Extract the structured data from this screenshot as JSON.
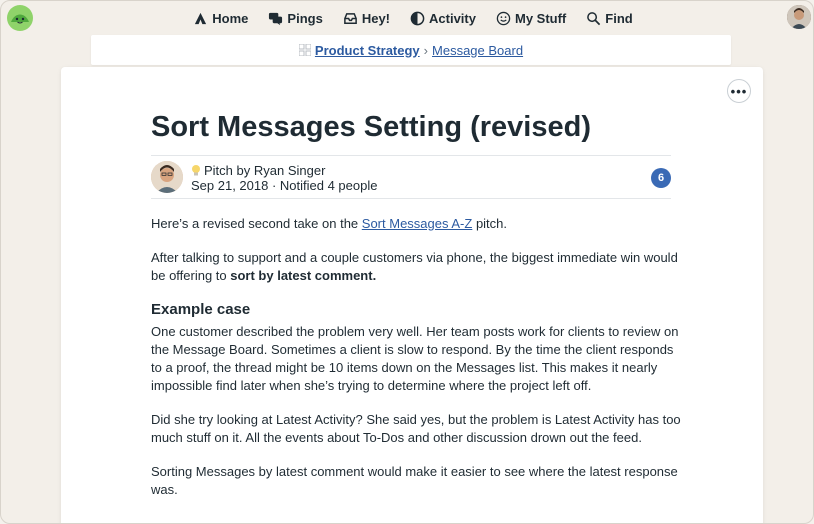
{
  "nav": {
    "home": "Home",
    "pings": "Pings",
    "hey": "Hey!",
    "activity": "Activity",
    "mystuff": "My Stuff",
    "find": "Find"
  },
  "breadcrumb": {
    "project": "Product Strategy",
    "separator": "›",
    "section": "Message Board"
  },
  "message": {
    "title": "Sort Messages Setting (revised)",
    "category_prefix": "Pitch by Ryan Singer",
    "meta": "Sep 21, 2018 · Notified 4 people",
    "comment_count": "6",
    "intro_before": "Here’s a revised second take on the ",
    "intro_link": "Sort Messages A-Z",
    "intro_after": " pitch.",
    "p2_before": "After talking to support and a couple customers via phone, the biggest immediate win would be offering to ",
    "p2_strong": "sort by latest comment.",
    "heading": "Example case",
    "p3": "One customer described the problem very well. Her team posts work for clients to review on the Message Board. Sometimes a client is slow to respond. By the time the client responds to a proof, the thread might be 10 items down on the Messages list. This makes it nearly impossible find later when she’s trying to determine where the project left off.",
    "p4": "Did she try looking at Latest Activity? She said yes, but the problem is Latest Activity has too much stuff on it. All the events about To-Dos and other discussion drown out the feed.",
    "p5": "Sorting Messages by latest comment would make it easier to see where the latest response was."
  },
  "colors": {
    "accent": "#2c5aa0",
    "badge": "#3a6ab5",
    "logo": "#8fd36a"
  }
}
